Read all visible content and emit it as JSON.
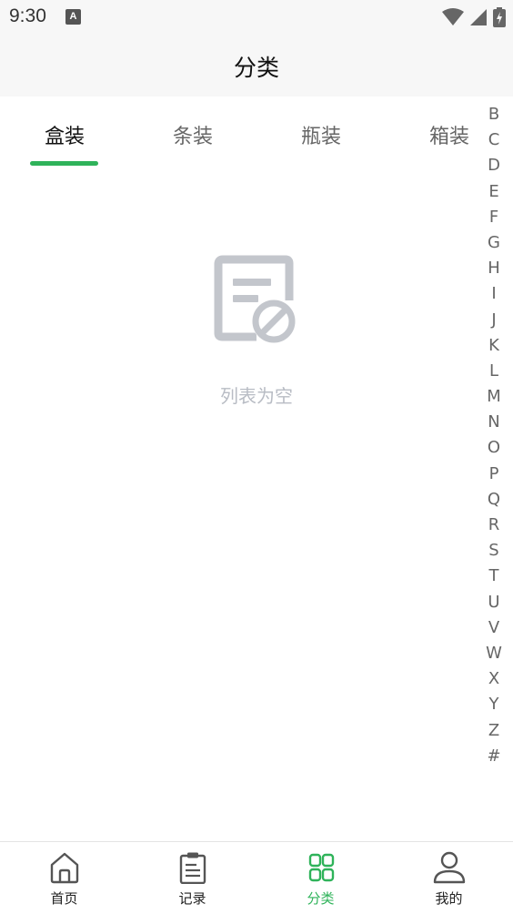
{
  "status_bar": {
    "time": "9:30",
    "app_icon_letter": "A",
    "icons": [
      "wifi-icon",
      "signal-icon",
      "battery-charging-icon"
    ]
  },
  "header": {
    "title": "分类"
  },
  "tabs": [
    {
      "label": "盒装",
      "active": true
    },
    {
      "label": "条装",
      "active": false
    },
    {
      "label": "瓶装",
      "active": false
    },
    {
      "label": "箱装",
      "active": false
    }
  ],
  "empty_state": {
    "icon": "empty-list-icon",
    "text": "列表为空"
  },
  "alphabet_index": [
    "B",
    "C",
    "D",
    "E",
    "F",
    "G",
    "H",
    "I",
    "J",
    "K",
    "L",
    "M",
    "N",
    "O",
    "P",
    "Q",
    "R",
    "S",
    "T",
    "U",
    "V",
    "W",
    "X",
    "Y",
    "Z",
    "#"
  ],
  "bottom_nav": [
    {
      "label": "首页",
      "icon": "home-icon",
      "active": false
    },
    {
      "label": "记录",
      "icon": "clipboard-icon",
      "active": false
    },
    {
      "label": "分类",
      "icon": "grid-icon",
      "active": true
    },
    {
      "label": "我的",
      "icon": "user-icon",
      "active": false
    }
  ],
  "colors": {
    "accent": "#2fb35a",
    "header_bg": "#f7f7f7",
    "empty_gray": "#c3c6cc"
  }
}
